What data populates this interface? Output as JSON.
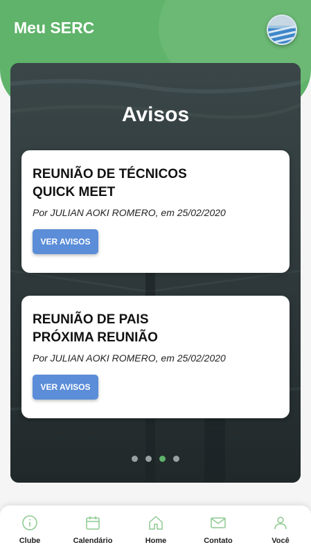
{
  "header": {
    "title": "Meu SERC",
    "avatar_icon": "profile-photo-pool",
    "color": "#5fb36a"
  },
  "panel": {
    "title": "Avisos",
    "background_icon": "swimming-pool-photo",
    "cards": [
      {
        "title_lines": [
          "REUNIÃO DE TÉCNICOS",
          "QUICK MEET"
        ],
        "meta": "Por JULIAN AOKI ROMERO, em 25/02/2020",
        "button_label": "VER AVISOS"
      },
      {
        "title_lines": [
          "REUNIÃO DE PAIS",
          "PRÓXIMA REUNIÃO"
        ],
        "meta": "Por JULIAN AOKI ROMERO, em 25/02/2020",
        "button_label": "VER AVISOS"
      }
    ],
    "carousel": {
      "count": 4,
      "active_index": 2
    },
    "button_color": "#5b8dd8"
  },
  "bottom_nav": {
    "items": [
      {
        "label": "Clube",
        "icon": "info-icon"
      },
      {
        "label": "Calendário",
        "icon": "calendar-icon"
      },
      {
        "label": "Home",
        "icon": "home-icon"
      },
      {
        "label": "Contato",
        "icon": "mail-icon"
      },
      {
        "label": "Você",
        "icon": "user-icon"
      }
    ],
    "icon_color": "#8cc98f"
  }
}
